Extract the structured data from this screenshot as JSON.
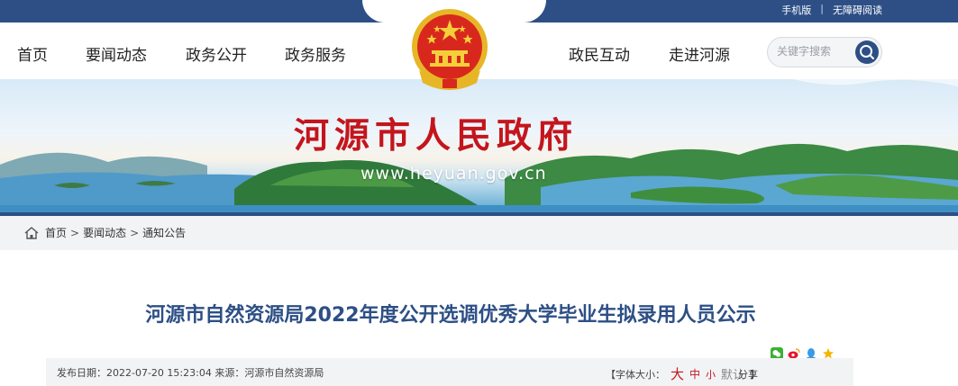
{
  "top_links": {
    "mobile": "手机版",
    "separator": "|",
    "accessible": "无障碍阅读"
  },
  "nav": {
    "items": [
      "首页",
      "要闻动态",
      "政务公开",
      "政务服务",
      "政民互动",
      "走进河源"
    ]
  },
  "search": {
    "placeholder": "关键字搜索"
  },
  "banner": {
    "title": "河源市人民政府",
    "url": "www.heyuan.gov.cn"
  },
  "breadcrumb": {
    "items": [
      "首页",
      "要闻动态",
      "通知公告"
    ],
    "separator": ">"
  },
  "article": {
    "title": "河源市自然资源局2022年度公开选调优秀大学毕业生拟录用人员公示",
    "meta": "发布日期：2022-07-20 15:23:04 来源：河源市自然资源局",
    "font_size_label": "【字体大小：",
    "font_large": "大",
    "font_medium": "中",
    "font_small": "小",
    "font_default": "默认",
    "font_close": "】",
    "share_label": "分享"
  },
  "colors": {
    "brand_blue": "#2d4f85",
    "brand_red": "#c4151c"
  }
}
